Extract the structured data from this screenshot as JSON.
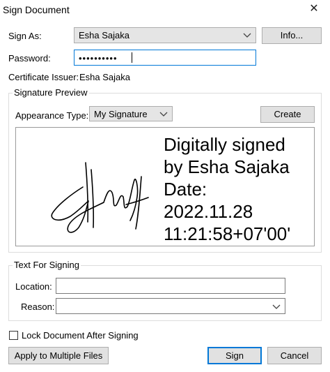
{
  "window": {
    "title": "Sign Document",
    "close_glyph": "✕"
  },
  "sign_as": {
    "label": "Sign As:",
    "value": "Esha Sajaka",
    "info_button": "Info..."
  },
  "password": {
    "label": "Password:",
    "masked_value": "••••••••••"
  },
  "certificate": {
    "label": "Certificate Issuer:",
    "value": "Esha Sajaka"
  },
  "signature_preview": {
    "group_title": "Signature Preview",
    "appearance_label": "Appearance Type:",
    "appearance_value": "My Signature",
    "create_button": "Create",
    "signed_text": "Digitally signed\nby Esha Sajaka\nDate:\n2022.11.28\n11:21:58+07'00'"
  },
  "text_for_signing": {
    "group_title": "Text For Signing",
    "location_label": "Location:",
    "location_value": "",
    "reason_label": "Reason:",
    "reason_value": ""
  },
  "lock_document": {
    "label": "Lock Document After Signing",
    "checked": false
  },
  "buttons": {
    "apply_multiple": "Apply to Multiple Files",
    "sign": "Sign",
    "cancel": "Cancel"
  },
  "colors": {
    "accent": "#0078d7",
    "button_bg": "#e1e1e1",
    "combo_bg": "#e5e5e5"
  },
  "icons": [
    "close-icon",
    "chevron-down-icon",
    "signature-image"
  ]
}
